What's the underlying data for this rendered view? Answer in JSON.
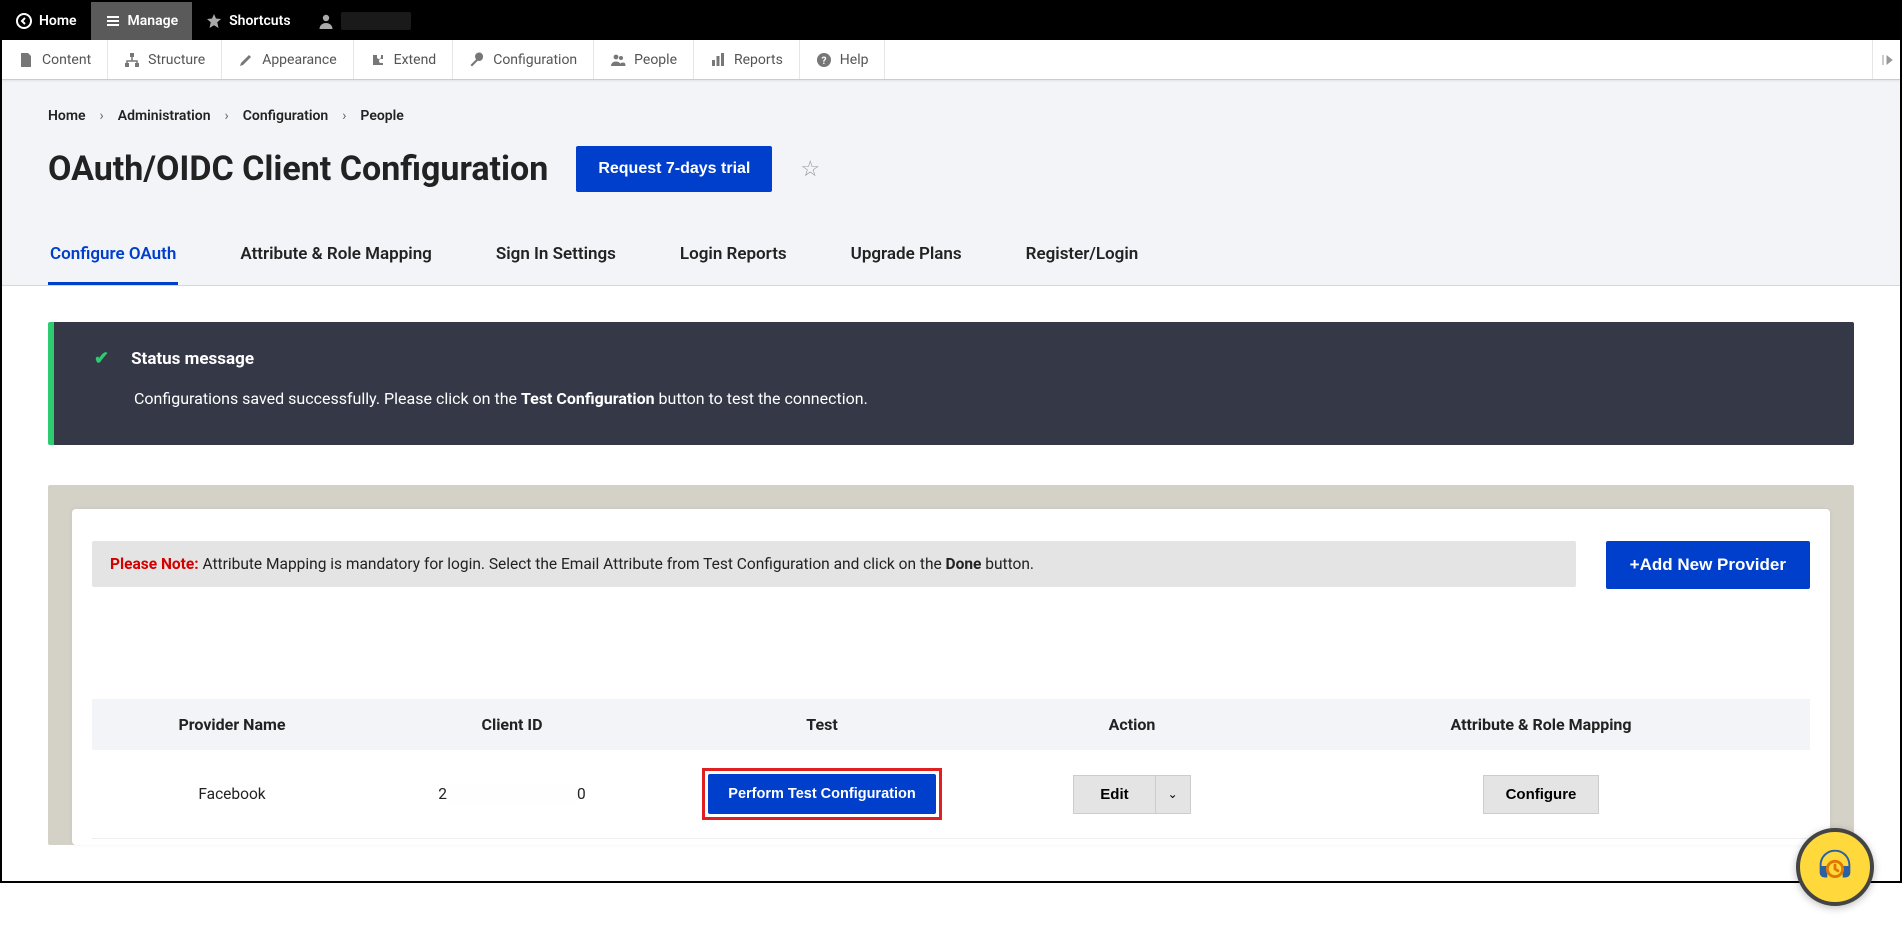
{
  "topbar": {
    "home": "Home",
    "manage": "Manage",
    "shortcuts": "Shortcuts"
  },
  "admin_toolbar": {
    "content": "Content",
    "structure": "Structure",
    "appearance": "Appearance",
    "extend": "Extend",
    "configuration": "Configuration",
    "people": "People",
    "reports": "Reports",
    "help": "Help"
  },
  "breadcrumbs": {
    "home": "Home",
    "admin": "Administration",
    "config": "Configuration",
    "people": "People"
  },
  "page": {
    "title": "OAuth/OIDC Client Configuration",
    "trial_button": "Request 7-days trial"
  },
  "tabs": {
    "configure": "Configure OAuth",
    "mapping": "Attribute & Role Mapping",
    "signin": "Sign In Settings",
    "reports": "Login Reports",
    "upgrade": "Upgrade Plans",
    "register": "Register/Login"
  },
  "status": {
    "title": "Status message",
    "body_pre": "Configurations saved successfully. Please click on the ",
    "body_bold": "Test Configuration",
    "body_post": " button to test the connection."
  },
  "note": {
    "label": "Please Note:",
    "text_pre": " Attribute Mapping is mandatory for login. Select the Email Attribute from Test Configuration and click on the ",
    "bold": "Done",
    "text_post": " button."
  },
  "buttons": {
    "add_provider": "+Add New Provider",
    "perform_test": "Perform Test Configuration",
    "edit": "Edit",
    "configure": "Configure"
  },
  "table": {
    "headers": {
      "provider": "Provider Name",
      "client_id": "Client ID",
      "test": "Test",
      "action": "Action",
      "attr": "Attribute & Role Mapping"
    },
    "rows": [
      {
        "provider": "Facebook",
        "client_id_prefix": "2",
        "client_id_suffix": "0"
      }
    ]
  }
}
